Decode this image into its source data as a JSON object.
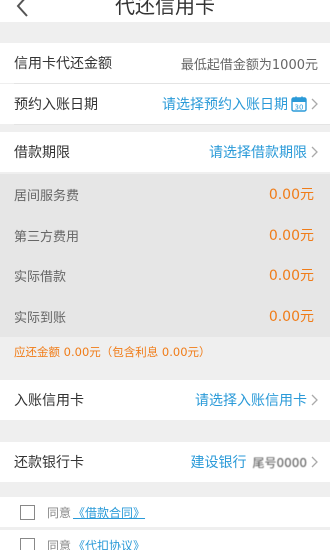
{
  "header": {
    "title": "代还信用卡"
  },
  "rows": {
    "amount": {
      "label": "信用卡代还金额",
      "hint": "最低起借金额为1000元"
    },
    "date": {
      "label": "预约入账日期",
      "link": "请选择预约入账日期",
      "calendar_day": "30"
    },
    "term": {
      "label": "借款期限",
      "link": "请选择借款期限"
    }
  },
  "fees": [
    {
      "label": "居间服务费",
      "value": "0.00元"
    },
    {
      "label": "第三方费用",
      "value": "0.00元"
    },
    {
      "label": "实际借款",
      "value": "0.00元"
    },
    {
      "label": "实际到账",
      "value": "0.00元"
    }
  ],
  "summary": "应还金额  0.00元（包含利息 0.00元）",
  "card": {
    "label": "入账信用卡",
    "link": "请选择入账信用卡"
  },
  "repay": {
    "label": "还款银行卡",
    "bank": "建设银行",
    "masked": "尾号0000"
  },
  "agreements": [
    {
      "prefix": "同意",
      "doc": "《借款合同》"
    },
    {
      "prefix": "同意",
      "doc": "《代扣协议》"
    }
  ],
  "colors": {
    "accent": "#2a9ad8",
    "money": "#f07c18",
    "background": "#efefef"
  }
}
